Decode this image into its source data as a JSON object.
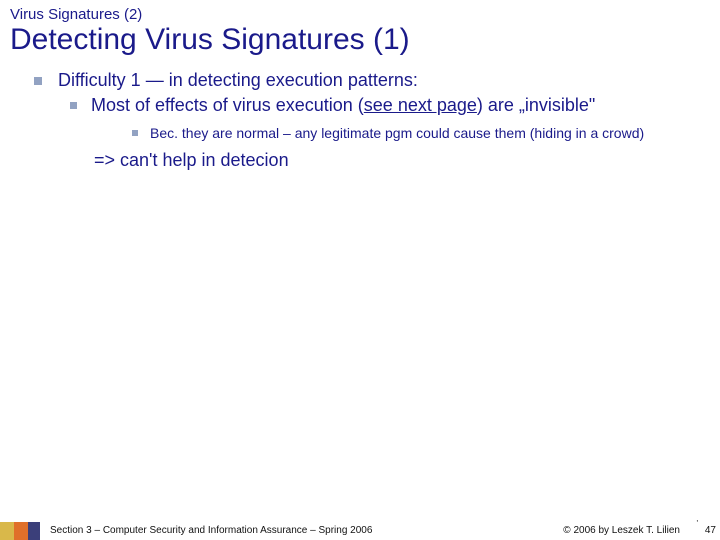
{
  "preTitle": "Virus Signatures (2)",
  "title": "Detecting Virus Signatures (1)",
  "l1": "Difficulty 1 — in detecting execution patterns:",
  "l2a": "Most of effects of virus execution (",
  "l2link": "see next page",
  "l2b": ") are „invisible\"",
  "l3": "Bec. they are normal – any legitimate pgm could cause them (hiding in a crowd)",
  "conclusion": "=> can't help in detecion",
  "footer": {
    "left": "Section 3 – Computer Security and Information Assurance – Spring 2006",
    "right": "© 2006 by Leszek T. Lilien",
    "page": "47",
    "tick": "'"
  }
}
